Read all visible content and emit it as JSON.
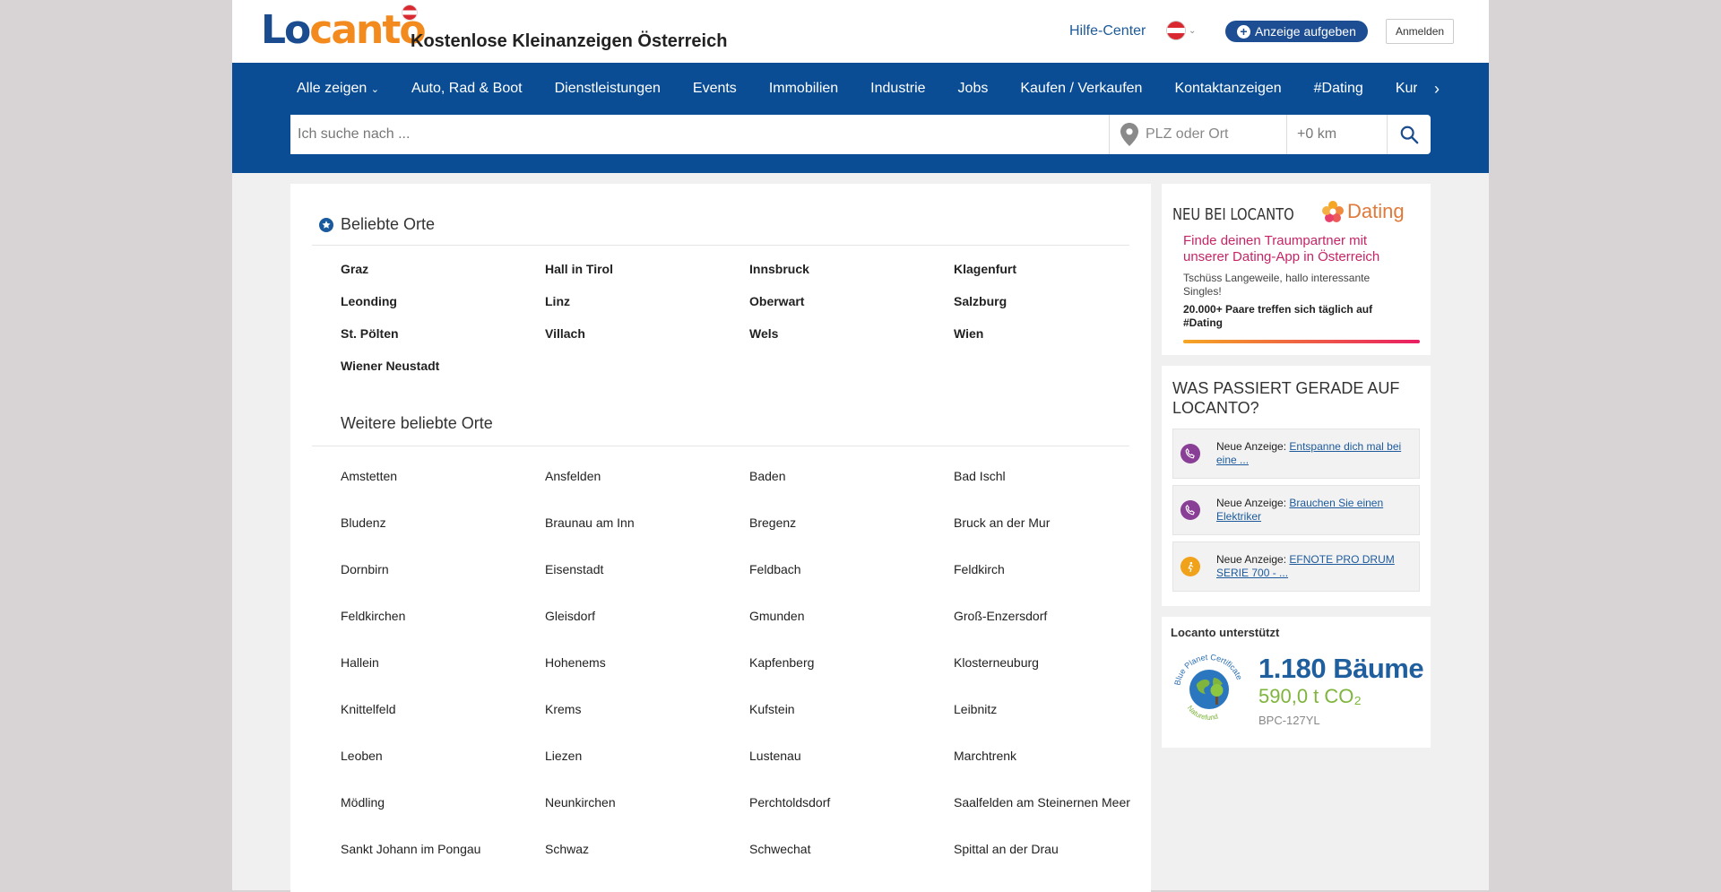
{
  "header": {
    "logo_part1": "Lo",
    "logo_part2": "canto",
    "site_title": "Kostenlose Kleinanzeigen Österreich",
    "help_link": "Hilfe-Center",
    "post_button": "Anzeige aufgeben",
    "login_button": "Anmelden"
  },
  "nav": {
    "items": [
      "Alle zeigen",
      "Auto, Rad & Boot",
      "Dienstleistungen",
      "Events",
      "Immobilien",
      "Industrie",
      "Jobs",
      "Kaufen / Verkaufen",
      "Kontaktanzeigen",
      "#Dating",
      "Kurse"
    ]
  },
  "search": {
    "query_placeholder": "Ich suche nach ...",
    "location_placeholder": "PLZ oder Ort",
    "radius": "+0 km"
  },
  "popular": {
    "title": "Beliebte Orte",
    "places": [
      "Graz",
      "Hall in Tirol",
      "Innsbruck",
      "Klagenfurt",
      "Leonding",
      "Linz",
      "Oberwart",
      "Salzburg",
      "St. Pölten",
      "Villach",
      "Wels",
      "Wien",
      "Wiener Neustadt"
    ]
  },
  "more_popular": {
    "title": "Weitere beliebte Orte",
    "places": [
      "Amstetten",
      "Ansfelden",
      "Baden",
      "Bad Ischl",
      "Bludenz",
      "Braunau am Inn",
      "Bregenz",
      "Bruck an der Mur",
      "Dornbirn",
      "Eisenstadt",
      "Feldbach",
      "Feldkirch",
      "Feldkirchen",
      "Gleisdorf",
      "Gmunden",
      "Groß-Enzersdorf",
      "Hallein",
      "Hohenems",
      "Kapfenberg",
      "Klosterneuburg",
      "Knittelfeld",
      "Krems",
      "Kufstein",
      "Leibnitz",
      "Leoben",
      "Liezen",
      "Lustenau",
      "Marchtrenk",
      "Mödling",
      "Neunkirchen",
      "Perchtoldsdorf",
      "Saalfelden am Steinernen Meer",
      "Sankt Johann im Pongau",
      "Schwaz",
      "Schwechat",
      "Spittal an der Drau"
    ]
  },
  "dating_promo": {
    "label": "NEU BEI LOCANTO",
    "brand": "Dating",
    "headline": "Finde deinen Traumpartner mit unserer Dating-App in Österreich",
    "subtext": "Tschüss Langeweile, hallo interessante Singles!",
    "stat": "20.000+ Paare treffen sich täglich auf #Dating"
  },
  "activity": {
    "title": "WAS PASSIERT GERADE AUF LOCANTO?",
    "prefix": "Neue Anzeige:",
    "items": [
      {
        "link": "Entspanne dich mal bei eine ...",
        "icon": "phone-icon",
        "color": "#8a3f96"
      },
      {
        "link": "Brauchen Sie einen Elektriker",
        "icon": "phone-icon",
        "color": "#8a3f96"
      },
      {
        "link": "EFNOTE PRO DRUM SERIE 700 - ...",
        "icon": "figure-icon",
        "color": "#f0a21b"
      }
    ]
  },
  "support": {
    "title": "Locanto unterstützt",
    "trees": "1.180 Bäume",
    "co2": "590,0 t CO₂",
    "certificate_id": "BPC-127YL",
    "seal_text_top": "Blue Planet Certificate",
    "seal_text_bottom": "Naturefund"
  },
  "colors": {
    "nav_blue": "#0a4d95",
    "logo_blue": "#1a4c8f",
    "logo_orange": "#f28a1e",
    "link_blue": "#1c5a9c",
    "dating_pink": "#c72466"
  }
}
